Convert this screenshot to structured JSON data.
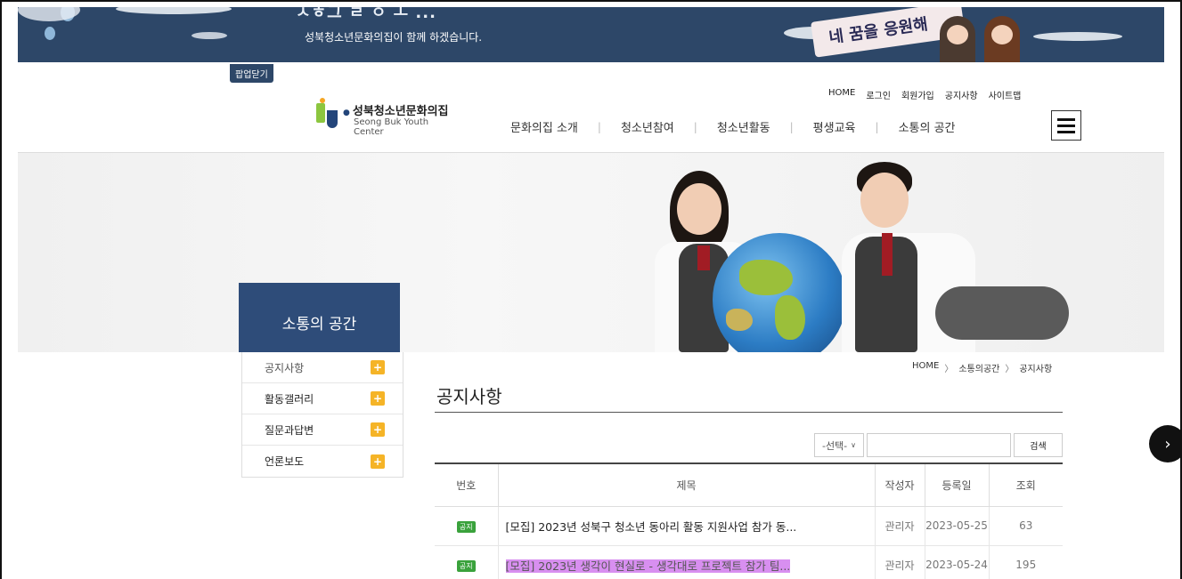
{
  "banner": {
    "heading": "ㅅㅎ그 ㄹ ㅇ ㅗ ...",
    "subtitle": "성북청소년문화의집이 함께 하겠습니다.",
    "sign_text": "네 꿈을 응원해"
  },
  "popup_close_label": "팝업닫기",
  "logo": {
    "name_ko": "성북청소년문화의집",
    "name_en": "Seong Buk Youth Center"
  },
  "utility_nav": [
    "HOME",
    "로그인",
    "회원가입",
    "공지사항",
    "사이트맵"
  ],
  "main_nav": [
    "문화의집 소개",
    "청소년참여",
    "청소년활동",
    "평생교육",
    "소통의 공간"
  ],
  "sidebar": {
    "title": "소통의 공간",
    "items": [
      {
        "label": "공지사항",
        "icon": "plus-icon"
      },
      {
        "label": "활동갤러리",
        "icon": "plus-icon"
      },
      {
        "label": "질문과답변",
        "icon": "plus-icon"
      },
      {
        "label": "언론보도",
        "icon": "plus-icon"
      }
    ]
  },
  "breadcrumb": [
    "HOME",
    "소통의공간",
    "공지사항"
  ],
  "page_title": "공지사항",
  "search": {
    "select_value": "-선택-",
    "input_value": "",
    "button_label": "검색"
  },
  "table": {
    "headers": [
      "번호",
      "제목",
      "작성자",
      "등록일",
      "조회"
    ],
    "rows": [
      {
        "badge": "공지",
        "title": "[모집] 2023년 성북구 청소년 동아리 활동 지원사업 참가 동...",
        "author": "관리자",
        "date": "2023-05-25",
        "views": "63"
      },
      {
        "badge": "공지",
        "title": "[모집] 2023년 생각이 현실로 - 생각대로 프로젝트 참가 팀...",
        "author": "관리자",
        "date": "2023-05-24",
        "views": "195"
      }
    ]
  },
  "colors": {
    "banner_bg": "#2d4768",
    "sidebar_title_bg": "#2e4c79",
    "plus_icon": "#f5b427",
    "notice_badge": "#3aa23c",
    "highlight": "#d88ff0"
  }
}
